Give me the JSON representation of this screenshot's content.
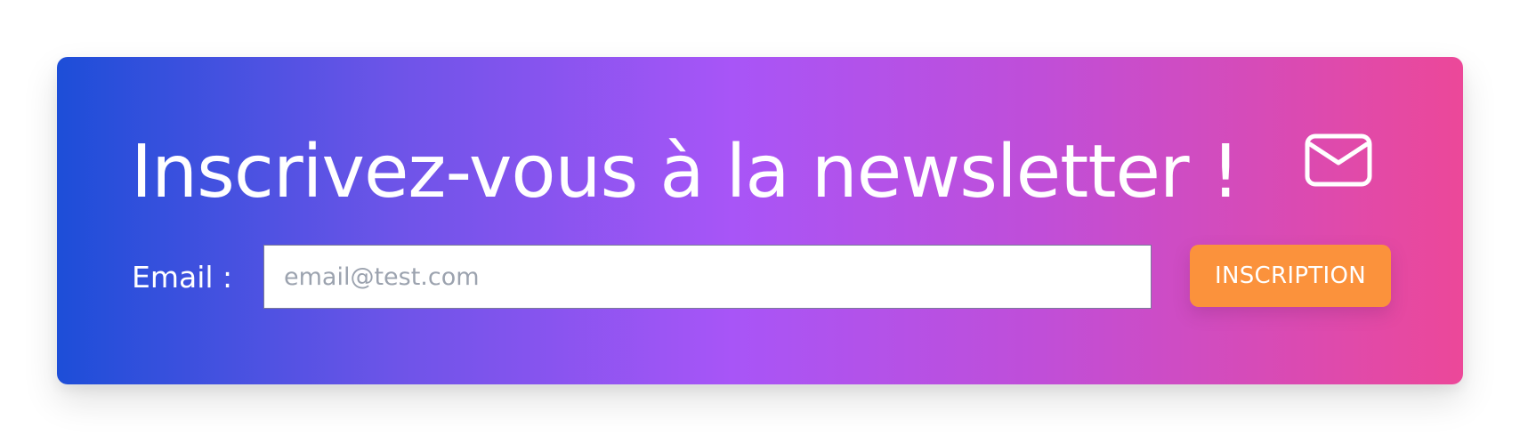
{
  "newsletter": {
    "title": "Inscrivez-vous à la newsletter !",
    "icon": "envelope-icon",
    "email_label": "Email :",
    "email_placeholder": "email@test.com",
    "email_value": "",
    "submit_label": "INSCRIPTION"
  },
  "colors": {
    "gradient_start": "#1d4ed8",
    "gradient_mid": "#a855f7",
    "gradient_end": "#ec4899",
    "button": "#fb923c",
    "text": "#ffffff"
  }
}
